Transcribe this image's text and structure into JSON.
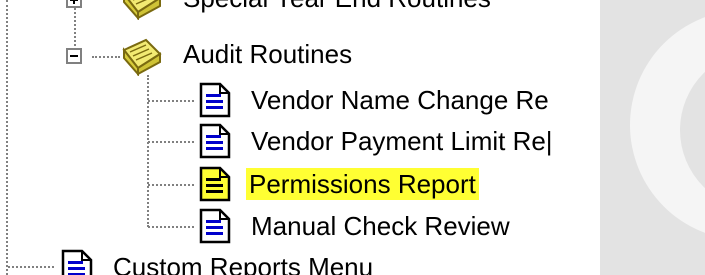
{
  "tree": {
    "items": [
      {
        "label": "Special Year End Routines",
        "icon": "book-folder-icon",
        "expander": "plus"
      },
      {
        "label": "Audit Routines",
        "icon": "book-folder-icon",
        "expander": "minus"
      },
      {
        "label": "Vendor Name Change Re",
        "icon": "report-icon"
      },
      {
        "label": "Vendor Payment Limit Re|",
        "icon": "report-icon"
      },
      {
        "label": "Permissions Report",
        "icon": "report-icon-selected",
        "selected": true
      },
      {
        "label": "Manual Check Review",
        "icon": "report-icon"
      },
      {
        "label": "Custom Reports Menu",
        "icon": "report-icon"
      }
    ]
  },
  "colors": {
    "selection_highlight": "#ffff33",
    "report_icon_lines": "#0000cc",
    "book_icon": "#e6d84a",
    "tree_lines": "#808080"
  }
}
